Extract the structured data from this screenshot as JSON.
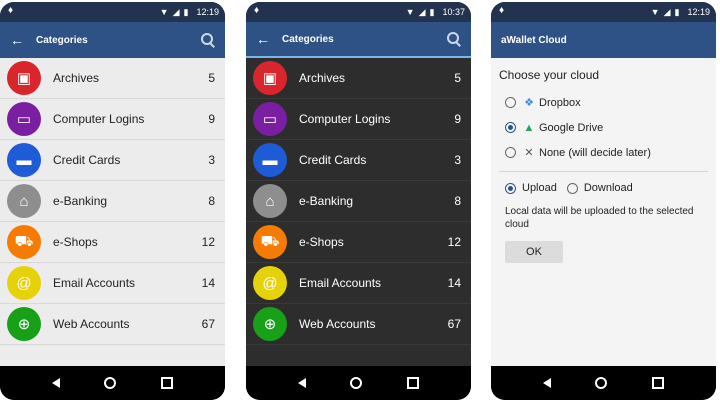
{
  "status": {
    "light_time": "12:19",
    "dark_time": "10:37",
    "cloud_time": "12:19"
  },
  "categories_screen": {
    "title": "Categories",
    "items": [
      {
        "name": "Archives",
        "count": "5",
        "color": "#d9262c",
        "icon": "archive-icon"
      },
      {
        "name": "Computer Logins",
        "count": "9",
        "color": "#7b1fa2",
        "icon": "laptop-icon"
      },
      {
        "name": "Credit Cards",
        "count": "3",
        "color": "#1e5bd6",
        "icon": "credit-card-icon"
      },
      {
        "name": "e-Banking",
        "count": "8",
        "color": "#8e8e8e",
        "icon": "bank-icon"
      },
      {
        "name": "e-Shops",
        "count": "12",
        "color": "#f57c00",
        "icon": "cart-icon"
      },
      {
        "name": "Email Accounts",
        "count": "14",
        "color": "#e6d20a",
        "icon": "at-icon"
      },
      {
        "name": "Web Accounts",
        "count": "67",
        "color": "#18a018",
        "icon": "globe-icon"
      }
    ]
  },
  "cloud_screen": {
    "title": "aWallet Cloud",
    "heading": "Choose your cloud",
    "providers": [
      {
        "label": "Dropbox",
        "icon": "dropbox-icon",
        "checked": false
      },
      {
        "label": "Google Drive",
        "icon": "google-drive-icon",
        "checked": true
      },
      {
        "label": "None (will decide later)",
        "icon": "close-icon",
        "checked": false
      }
    ],
    "direction": [
      {
        "label": "Upload",
        "checked": true
      },
      {
        "label": "Download",
        "checked": false
      }
    ],
    "note": "Local data will be uploaded to the selected cloud",
    "ok_label": "OK"
  },
  "colors": {
    "appbar": "#2f5286",
    "statusbar": "#22324f",
    "dark_background": "#2d2d2d",
    "light_background": "#ececec"
  }
}
